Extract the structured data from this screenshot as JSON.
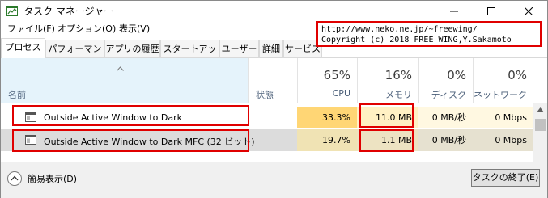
{
  "window": {
    "title": "タスク マネージャー",
    "minimize_glyph": "—",
    "maximize_glyph": "☐",
    "close_glyph": "✕"
  },
  "menu": [
    "ファイル(F)",
    "オプション(O)",
    "表示(V)"
  ],
  "tabs": [
    "プロセス",
    "パフォーマンス",
    "アプリの履歴",
    "スタートアップ",
    "ユーザー",
    "詳細",
    "サービス"
  ],
  "active_tab": "プロセス",
  "header": {
    "name": "名前",
    "status": "状態",
    "cpu": {
      "percent": "65%",
      "label": "CPU"
    },
    "memory": {
      "percent": "16%",
      "label": "メモリ"
    },
    "disk": {
      "percent": "0%",
      "label": "ディスク"
    },
    "network": {
      "percent": "0%",
      "label": "ネットワーク"
    }
  },
  "rows": [
    {
      "name": "Outside Active Window to Dark",
      "cpu": "33.3%",
      "memory": "11.0 MB",
      "disk": "0 MB/秒",
      "network": "0 Mbps"
    },
    {
      "name": "Outside Active Window to Dark MFC (32 ビット)",
      "cpu": "19.7%",
      "memory": "1.1 MB",
      "disk": "0 MB/秒",
      "network": "0 Mbps"
    }
  ],
  "footer": {
    "fewer_details": "簡易表示(D)",
    "end_task": "タスクの終了(E)"
  },
  "overlay": {
    "url": "http://www.neko.ne.jp/~freewing/",
    "copyright": "Copyright (c) 2018 FREE WING,Y.Sakamoto"
  },
  "colors": {
    "cpu_heat_row1": "#ffd675",
    "cpu_heat_row2": "#fbeec5",
    "mem_heat_row1": "#fff1c4",
    "mem_heat_row2": "#fbf3d8",
    "sorted_header": "#e5f3fb",
    "highlight_box": "#e00000",
    "header_label": "#4c607a"
  }
}
